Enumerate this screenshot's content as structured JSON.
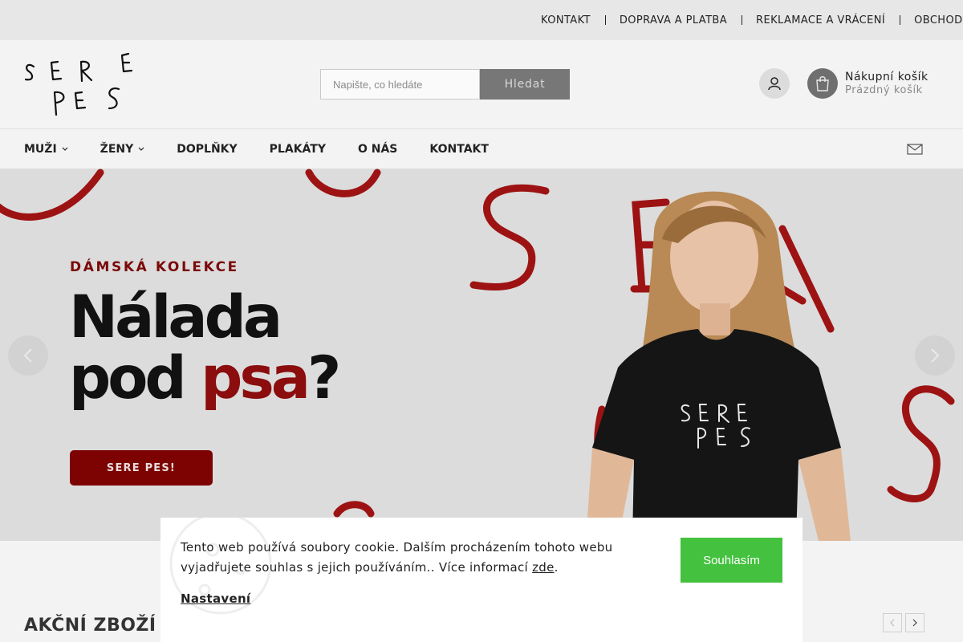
{
  "topbar": {
    "links": [
      "KONTAKT",
      "DOPRAVA A PLATBA",
      "REKLAMACE A VRÁCENÍ",
      "OBCHODNÍ PODMÍNKY"
    ]
  },
  "header": {
    "logo_lines": [
      "SERE",
      "PES"
    ],
    "search_placeholder": "Napište, co hledáte",
    "search_button": "Hledat",
    "cart_title": "Nákupní košík",
    "cart_status": "Prázdný košík"
  },
  "nav": {
    "items": [
      "MUŽI",
      "ŽENY",
      "DOPLŇKY",
      "PLAKÁTY",
      "O NÁS",
      "KONTAKT"
    ]
  },
  "hero": {
    "kicker": "DÁMSKÁ KOLEKCE",
    "headline_line1": "Nálada",
    "headline_line2_black": "pod ",
    "headline_line2_red": "psa",
    "headline_line2_end": "?",
    "cta": "SERE PES!",
    "shirt_print_lines": [
      "SERE",
      "PES"
    ]
  },
  "section": {
    "title": "AKČNÍ ZBOŽÍ"
  },
  "cookie": {
    "text": "Tento web používá soubory cookie. Dalším procházením tohoto webu vyjadřujete souhlas s jejich používáním.. Více informací ",
    "link": "zde",
    "text_end": ".",
    "settings": "Nastavení",
    "accept": "Souhlasím"
  },
  "colors": {
    "accent_red": "#8b0d0d",
    "accept_green": "#44c13e"
  }
}
